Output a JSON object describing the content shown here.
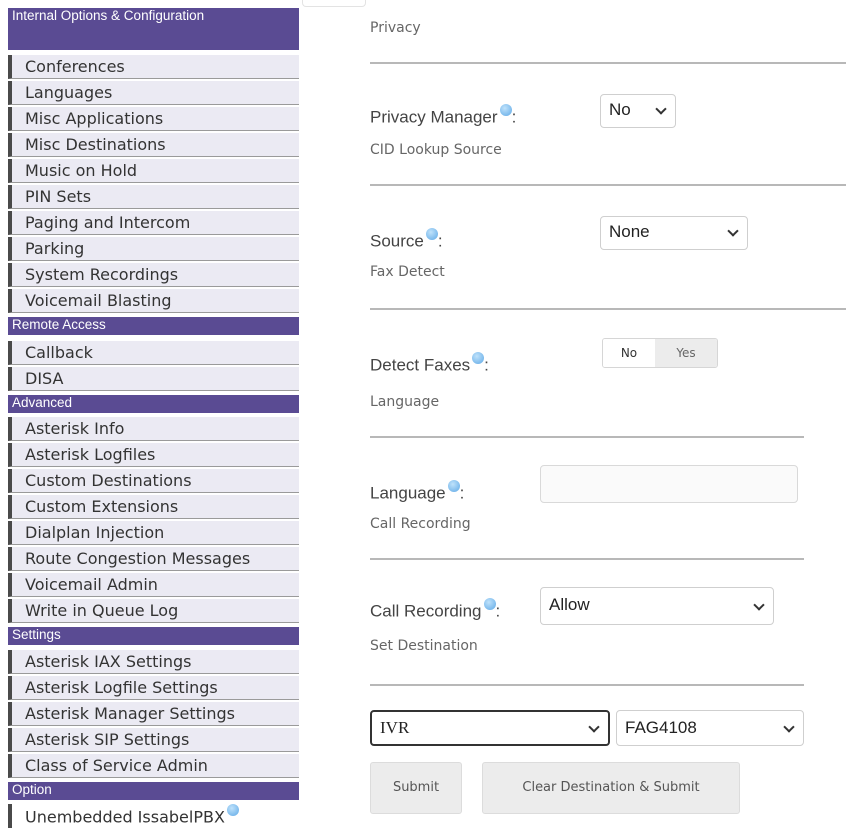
{
  "sidebar": {
    "cat_internal": "Internal Options & Configuration",
    "internal_items": [
      "Conferences",
      "Languages",
      "Misc Applications",
      "Misc Destinations",
      "Music on Hold",
      "PIN Sets",
      "Paging and Intercom",
      "Parking",
      "System Recordings",
      "Voicemail Blasting"
    ],
    "cat_remote": "Remote Access",
    "remote_items": [
      "Callback",
      "DISA"
    ],
    "cat_advanced": "Advanced",
    "advanced_items": [
      "Asterisk Info",
      "Asterisk Logfiles",
      "Custom Destinations",
      "Custom Extensions",
      "Dialplan Injection",
      "Route Congestion Messages",
      "Voicemail Admin",
      "Write in Queue Log"
    ],
    "cat_settings": "Settings",
    "settings_items": [
      "Asterisk IAX Settings",
      "Asterisk Logfile Settings",
      "Asterisk Manager Settings",
      "Asterisk SIP Settings",
      "Class of Service Admin"
    ],
    "cat_option": "Option",
    "option_items": [
      "Unembedded IssabelPBX"
    ]
  },
  "form": {
    "privacy_section": "Privacy",
    "privacy_manager_label": "Privacy Manager",
    "privacy_manager_value": "No",
    "cid_section": "CID Lookup Source",
    "source_label": "Source",
    "source_value": "None",
    "fax_section": "Fax Detect",
    "detect_faxes_label": "Detect Faxes",
    "detect_no": "No",
    "detect_yes": "Yes",
    "language_section": "Language",
    "language_label": "Language",
    "language_value": "",
    "call_recording_section": "Call Recording",
    "call_recording_label": "Call Recording",
    "call_recording_value": "Allow",
    "destination_section": "Set Destination",
    "dest_type_value": "IVR",
    "dest_value": "FAG4108",
    "colon": ":",
    "submit_label": "Submit",
    "clear_submit_label": "Clear Destination & Submit"
  },
  "colors": {
    "category_bg": "#5a4b93",
    "item_bg": "#ebeaf3",
    "help_icon": "#5fa9e6"
  }
}
